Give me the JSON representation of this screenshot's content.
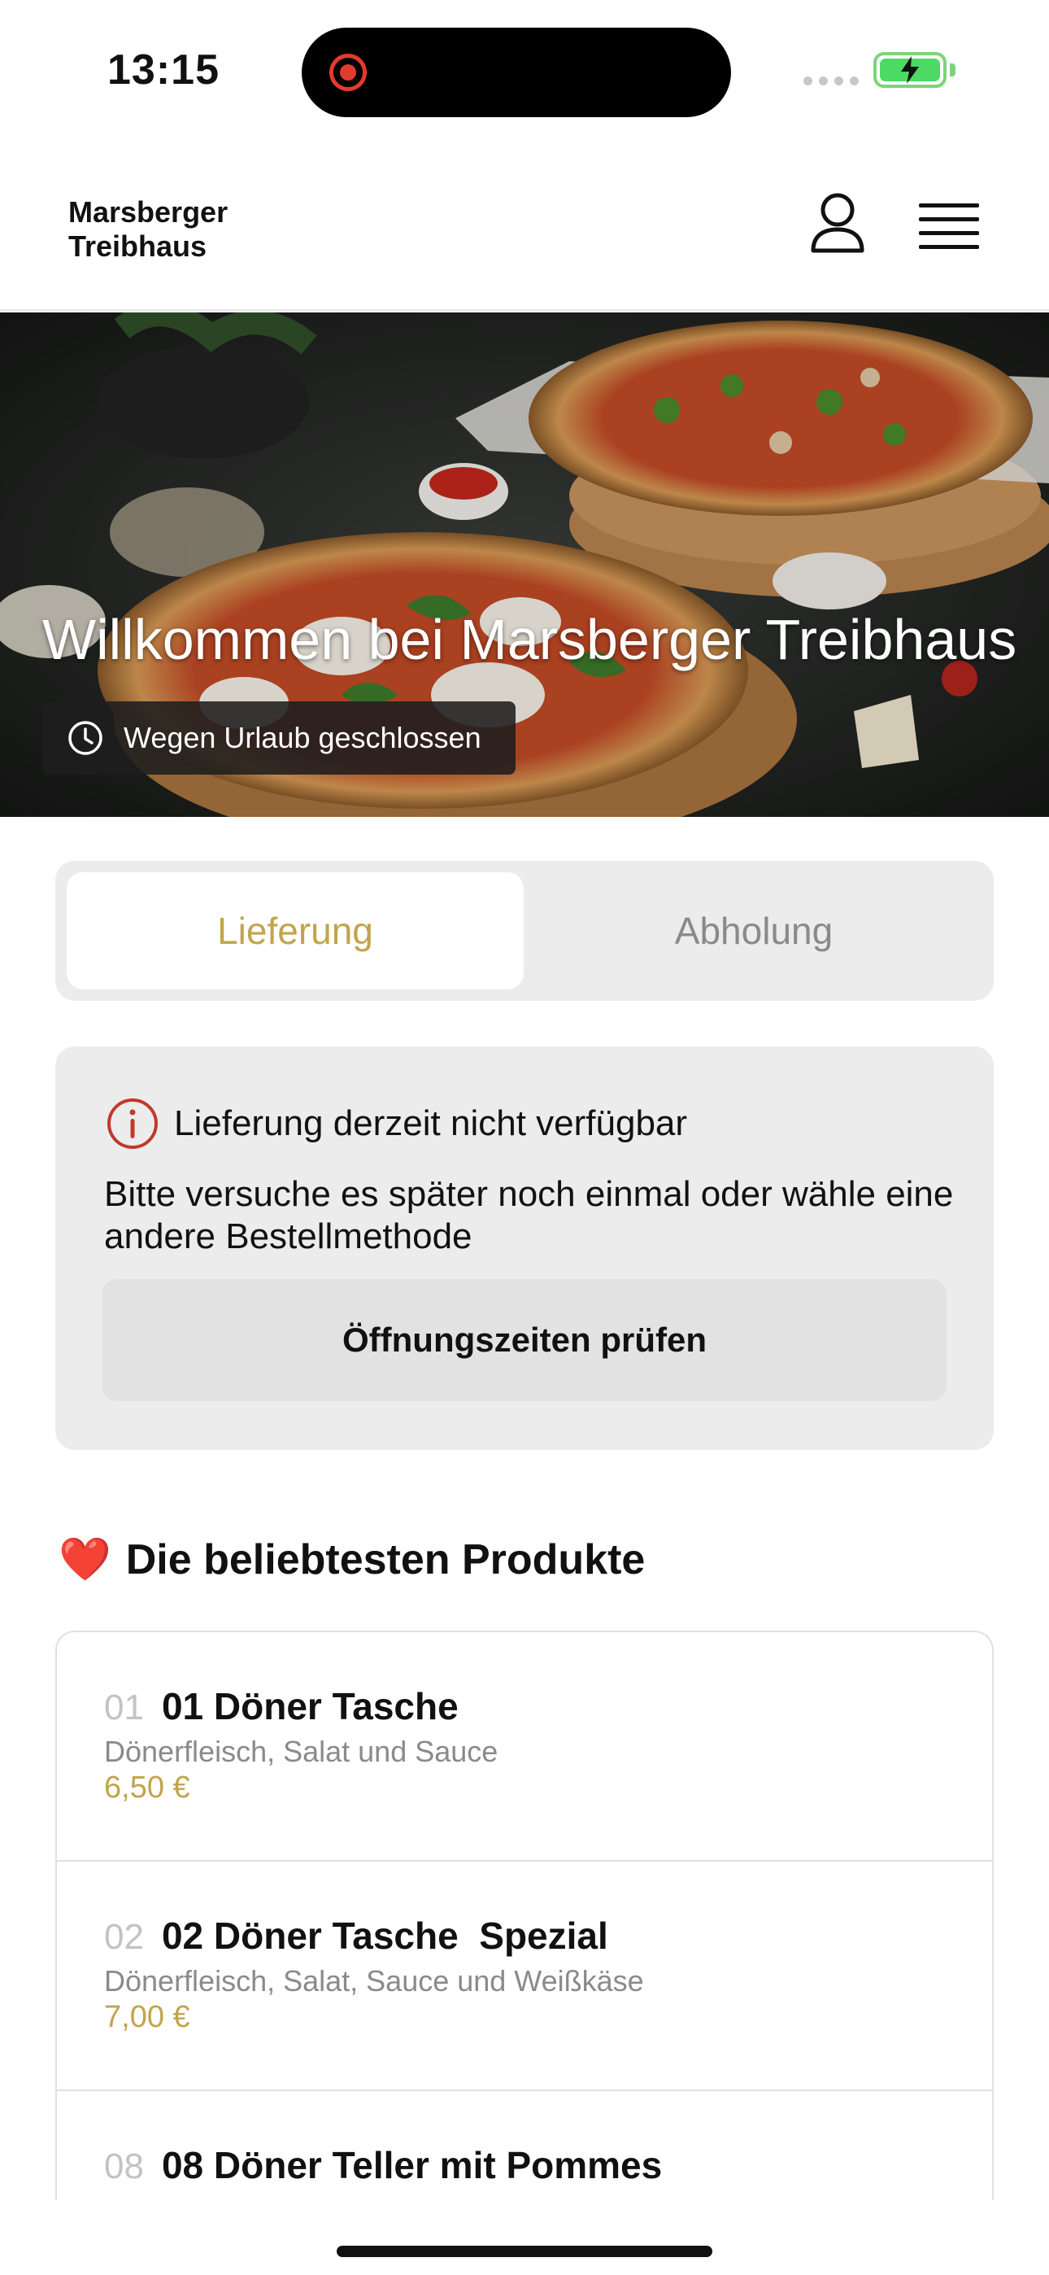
{
  "status_bar": {
    "time": "13:15"
  },
  "header": {
    "brand": "Marsberger Treibhaus",
    "icons": {
      "account": "person-icon",
      "menu": "hamburger-menu-icon"
    }
  },
  "hero": {
    "title": "Willkommen bei Marsberger Treibhaus",
    "status_badge": "Wegen Urlaub geschlossen",
    "status_icon": "clock-icon"
  },
  "order_mode": {
    "options": [
      "Lieferung",
      "Abholung"
    ],
    "selected": "Lieferung"
  },
  "notice": {
    "icon": "info-icon",
    "title": "Lieferung derzeit nicht verfügbar",
    "text": "Bitte versuche es später noch einmal oder wähle eine andere Bestellmethode",
    "button_label": "Öffnungszeiten prüfen"
  },
  "popular": {
    "emoji": "❤️",
    "title": "Die beliebtesten Produkte",
    "products": [
      {
        "number": "01",
        "name": "01 Döner Tasche",
        "description": "Dönerfleisch, Salat und Sauce",
        "price": "6,50 €"
      },
      {
        "number": "02",
        "name": "02 Döner Tasche  Spezial",
        "description": "Dönerfleisch, Salat, Sauce und Weißkäse",
        "price": "7,00 €"
      },
      {
        "number": "08",
        "name": "08 Döner Teller mit Pommes",
        "description": "",
        "price": ""
      }
    ]
  },
  "colors": {
    "accent": "#c1a54c",
    "alert": "#c0392b",
    "card_bg": "#ececec"
  }
}
